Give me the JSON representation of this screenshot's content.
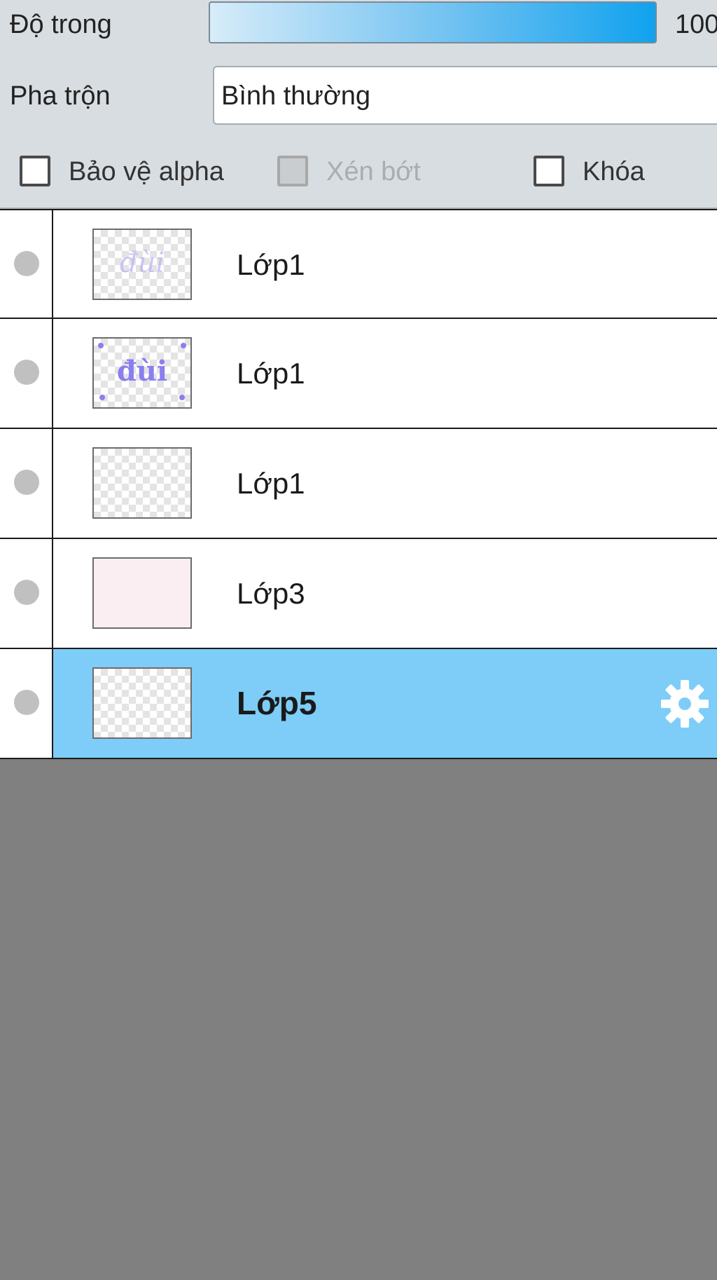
{
  "properties": {
    "opacity_label": "Độ trong",
    "opacity_value": "100",
    "opacity_level": 1.0,
    "blend_label": "Pha trộn",
    "blend_value": "Bình thường",
    "checks": [
      {
        "label": "Bảo vệ alpha",
        "checked": false,
        "disabled": false
      },
      {
        "label": "Xén bớt",
        "checked": false,
        "disabled": true
      },
      {
        "label": "Khóa",
        "checked": false,
        "disabled": false
      }
    ]
  },
  "layers": [
    {
      "name": "Lớp1",
      "thumb": "faint-text",
      "selected": false
    },
    {
      "name": "Lớp1",
      "thumb": "text",
      "selected": false
    },
    {
      "name": "Lớp1",
      "thumb": "empty",
      "selected": false
    },
    {
      "name": "Lớp3",
      "thumb": "pink",
      "selected": false
    },
    {
      "name": "Lớp5",
      "thumb": "empty",
      "selected": true
    }
  ],
  "colors": {
    "selected_row": "#7ecdf8",
    "panel_bg": "#d8dde1",
    "empty_area": "#808080"
  },
  "icons": {
    "visibility": "visibility-dot-icon",
    "settings": "gear-icon"
  }
}
